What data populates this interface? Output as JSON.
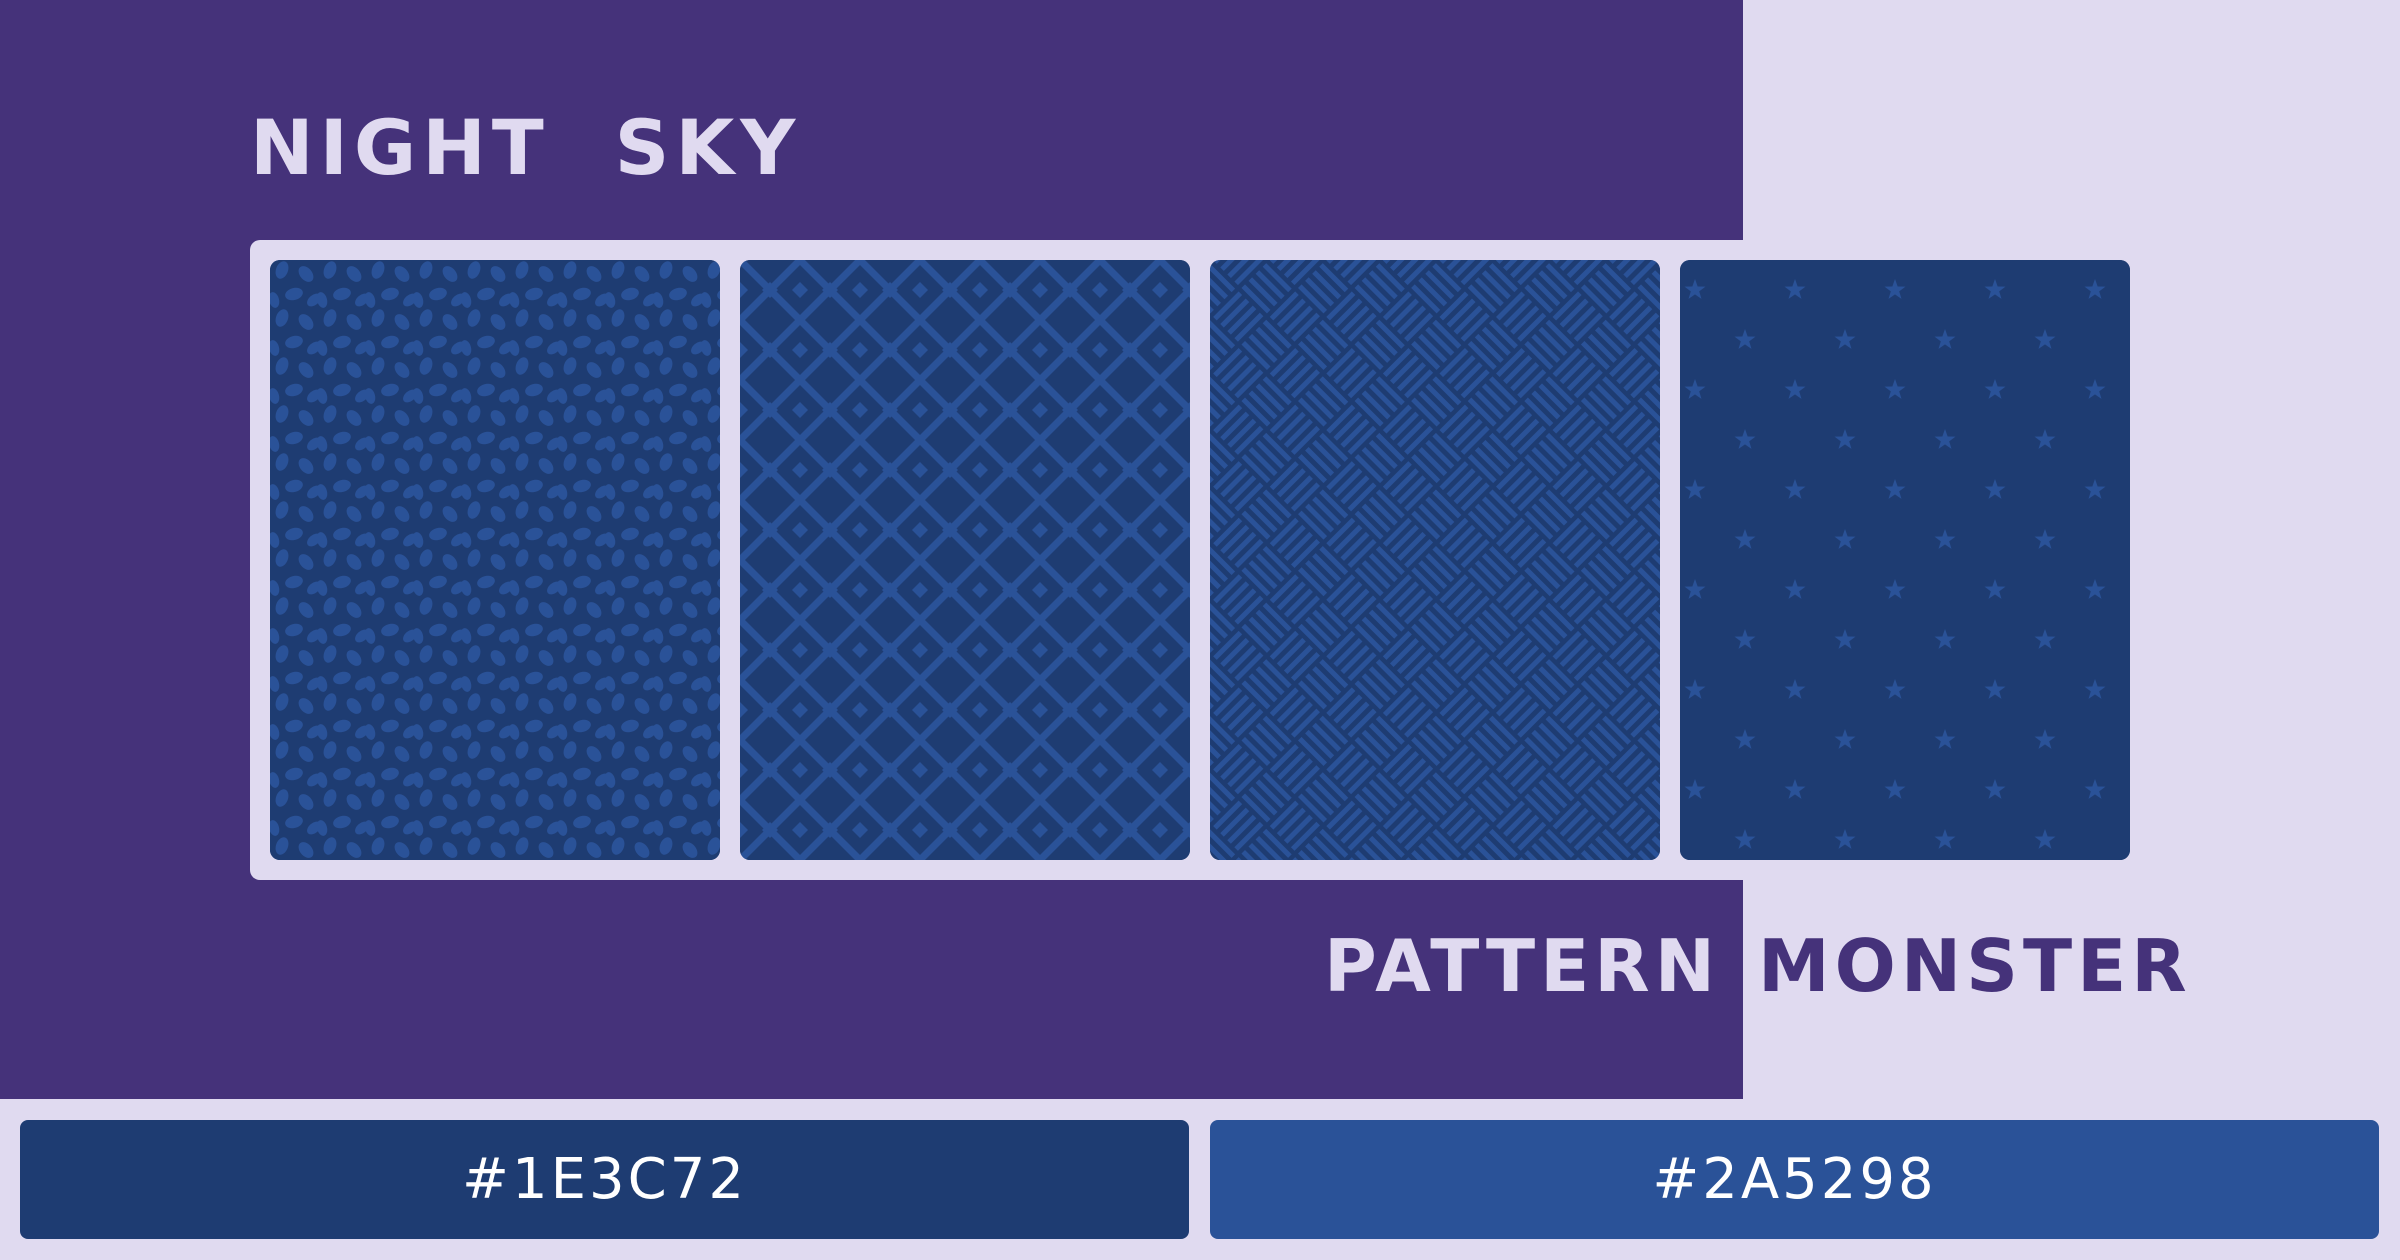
{
  "palette": {
    "title": "NIGHT  SKY",
    "brand_first": "PATTERN",
    "brand_second": "MONSTER",
    "panel_color": "#45327A",
    "light_color": "#E0DAF0",
    "swatches": [
      {
        "hex": "#1E3C72",
        "label": "#1E3C72"
      },
      {
        "hex": "#2A5298",
        "label": "#2A5298"
      }
    ],
    "tiles": [
      "petals-pattern",
      "cross-lattice-pattern",
      "basketweave-pattern",
      "stars-pattern"
    ]
  }
}
